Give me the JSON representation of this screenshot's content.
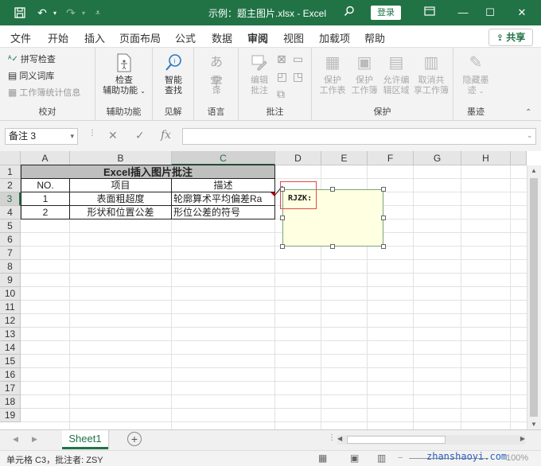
{
  "window": {
    "title": "示例：题主图片.xlsx - Excel",
    "login_label": "登录"
  },
  "menu": {
    "items": [
      "文件",
      "开始",
      "插入",
      "页面布局",
      "公式",
      "数据",
      "审阅",
      "视图",
      "加载项",
      "帮助"
    ],
    "active": "审阅",
    "share_label": "共享"
  },
  "ribbon": {
    "proofing": {
      "label": "校对",
      "spell_check": "拼写检查",
      "thesaurus": "同义词库",
      "workbook_stats": "工作簿统计信息"
    },
    "accessibility": {
      "label": "辅助功能",
      "check_line1": "检查",
      "check_line2": "辅助功能"
    },
    "insights": {
      "label": "见解",
      "smart_line1": "智能",
      "smart_line2": "查找"
    },
    "language": {
      "label": "语言",
      "translate_line1": "翻",
      "translate_line2": "译"
    },
    "comments": {
      "label": "批注",
      "edit_line1": "编辑",
      "edit_line2": "批注"
    },
    "protect": {
      "label": "保护",
      "buttons": [
        {
          "line1": "保护",
          "line2": "工作表"
        },
        {
          "line1": "保护",
          "line2": "工作簿"
        },
        {
          "line1": "允许编",
          "line2": "辑区域"
        },
        {
          "line1": "取消共",
          "line2": "享工作簿"
        }
      ]
    },
    "ink": {
      "label": "墨迹",
      "hide_line1": "隐藏墨",
      "hide_line2": "迹"
    }
  },
  "formula_bar": {
    "name_box": "备注 3",
    "fx": "fx",
    "value": ""
  },
  "columns": [
    "A",
    "B",
    "C",
    "D",
    "E",
    "F",
    "G",
    "H"
  ],
  "rows": [
    "1",
    "2",
    "3",
    "4",
    "5",
    "6",
    "7",
    "8",
    "9",
    "10",
    "11",
    "12",
    "13",
    "14",
    "15",
    "16",
    "17",
    "18",
    "19"
  ],
  "table": {
    "title": "Excel插入图片批注",
    "headers": [
      "NO.",
      "项目",
      "描述"
    ],
    "rows": [
      [
        "1",
        "表面粗超度",
        "轮廓算术平均偏差Ra"
      ],
      [
        "2",
        "形状和位置公差",
        "形位公差的符号"
      ]
    ]
  },
  "comment": {
    "author": "RJZK:"
  },
  "sheets": {
    "active": "Sheet1"
  },
  "status": {
    "text": "单元格 C3，批注者: ZSY",
    "zoom": "100%",
    "watermark": "zhanshaoyi.com"
  },
  "colors": {
    "accent": "#217346",
    "comment_bg": "#ffffe1",
    "title_fill": "#bfbfbf"
  }
}
